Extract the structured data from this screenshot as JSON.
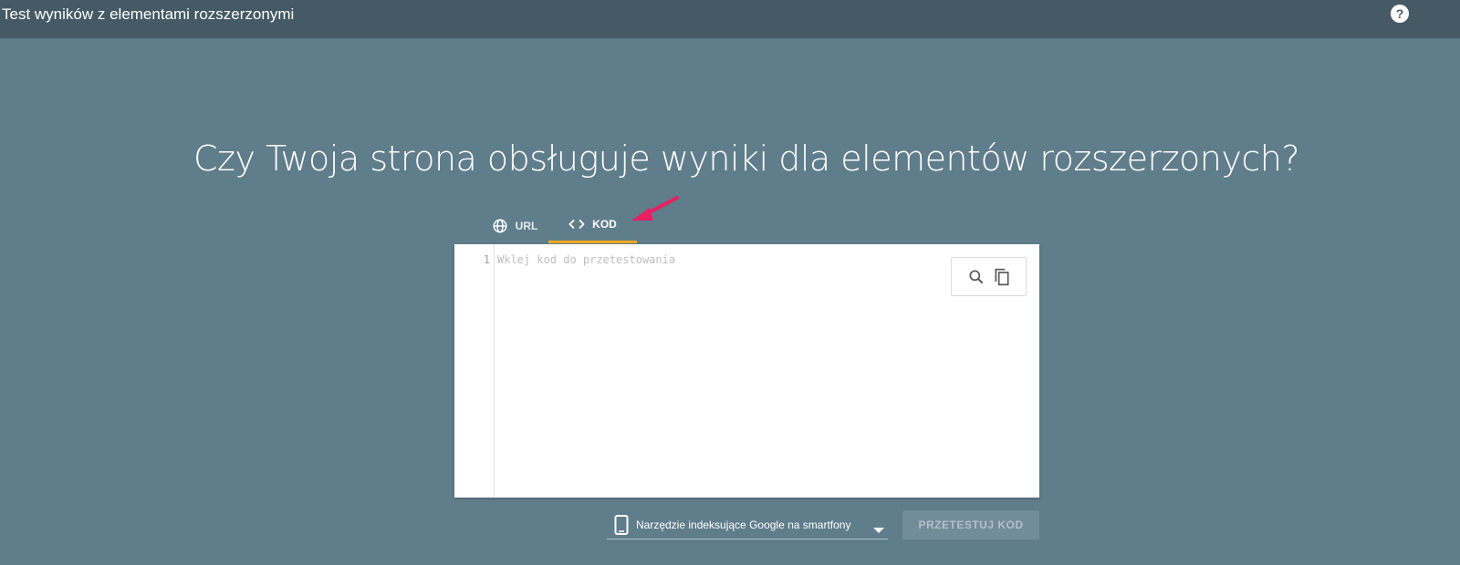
{
  "header": {
    "title": "Test wyników z elementami rozszerzonymi",
    "help_icon": "help-icon",
    "help_label": "?"
  },
  "main": {
    "headline": "Czy Twoja strona obsługuje wyniki dla elementów rozszerzonych?",
    "tabs": [
      {
        "label": "URL",
        "icon": "globe-icon",
        "selected": false
      },
      {
        "label": "KOD",
        "icon": "code-icon",
        "selected": true
      }
    ],
    "editor": {
      "line_number": "1",
      "placeholder": "Wklej kod do przetestowania",
      "tools": [
        "search-icon",
        "copy-icon"
      ]
    },
    "device_select": {
      "label": "Narzędzie indeksujące Google na smartfony",
      "icon": "smartphone-icon"
    },
    "submit_button": {
      "label": "PRZETESTUJ KOD",
      "enabled": false
    }
  },
  "colors": {
    "background": "#607d8b",
    "topbar": "#455a64",
    "tab_indicator": "#f9a825",
    "annotation_arrow": "#e91e63"
  }
}
